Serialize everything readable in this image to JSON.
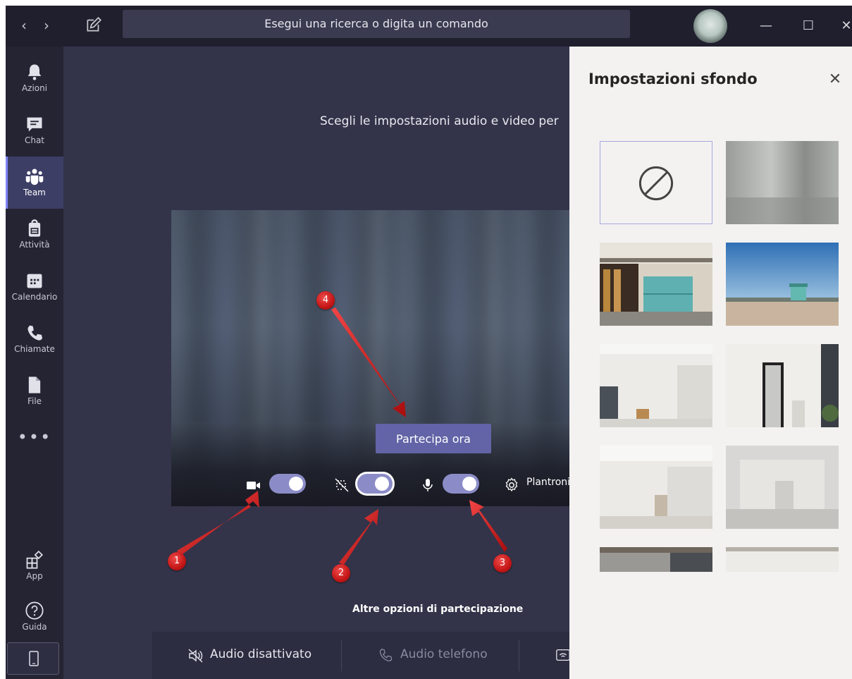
{
  "titlebar": {
    "back": "‹",
    "forward": "›",
    "search_placeholder": "Esegui una ricerca o digita un comando",
    "minimize": "—",
    "maximize": "☐",
    "close": "✕"
  },
  "rail": {
    "items": [
      {
        "label": "Azioni",
        "icon": "bell-icon"
      },
      {
        "label": "Chat",
        "icon": "chat-icon"
      },
      {
        "label": "Team",
        "icon": "team-icon",
        "active": true
      },
      {
        "label": "Attività",
        "icon": "assignment-icon"
      },
      {
        "label": "Calendario",
        "icon": "calendar-icon"
      },
      {
        "label": "Chiamate",
        "icon": "phone-icon"
      },
      {
        "label": "File",
        "icon": "file-icon"
      }
    ],
    "more": "•••",
    "bottom_items": [
      {
        "label": "App",
        "icon": "apps-icon"
      },
      {
        "label": "Guida",
        "icon": "help-icon"
      }
    ]
  },
  "stage": {
    "prompt": "Scegli le impostazioni audio e video per",
    "join_label": "Partecipa ora",
    "device_label": "Plantroni",
    "more_options": "Altre opzioni di partecipazione",
    "toggles": {
      "camera": true,
      "background_blur": true,
      "microphone": true
    },
    "bottom": {
      "audio_off": "Audio disattivato",
      "phone_audio": "Audio telefono"
    }
  },
  "annotations": [
    "1",
    "2",
    "3",
    "4"
  ],
  "panel": {
    "title": "Impostazioni sfondo",
    "close": "✕"
  },
  "colors": {
    "accent": "#6264a7",
    "app_bg": "#33344a",
    "rail_bg": "#242433",
    "titlebar_bg": "#1f1f2d",
    "panel_bg": "#f3f2f1",
    "marker": "#c41616"
  }
}
